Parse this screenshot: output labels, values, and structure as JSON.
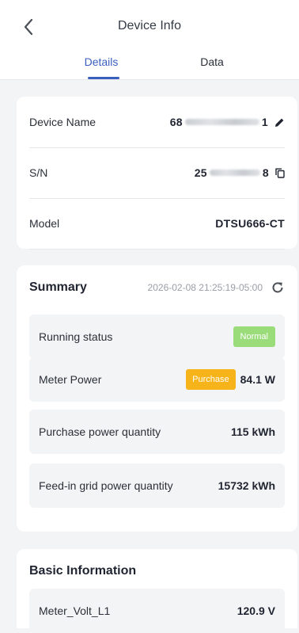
{
  "header": {
    "title": "Device Info",
    "tabs": [
      {
        "label": "Details",
        "active": true
      },
      {
        "label": "Data",
        "active": false
      }
    ]
  },
  "device": {
    "rows": [
      {
        "label": "Device Name",
        "value_start": "68",
        "value_end": "1",
        "action_icon": "pencil-icon"
      },
      {
        "label": "S/N",
        "value_start": "25",
        "value_end": "8",
        "action_icon": "copy-icon"
      },
      {
        "label": "Model",
        "value": "DTSU666-CT"
      }
    ]
  },
  "summary": {
    "title": "Summary",
    "timestamp": "2026-02-08 21:25:19-05:00",
    "running_status": {
      "label": "Running status",
      "badge": "Normal"
    },
    "meter_power": {
      "label": "Meter Power",
      "badge": "Purchase",
      "value": "84.1 W"
    },
    "purchase_power": {
      "label": "Purchase power quantity",
      "value": "115 kWh"
    },
    "feed_in": {
      "label": "Feed-in grid power quantity",
      "value": "15732 kWh"
    }
  },
  "basic_info": {
    "title": "Basic Information",
    "rows": [
      {
        "label": "Meter_Volt_L1",
        "value": "120.9 V"
      }
    ]
  },
  "colors": {
    "accent": "#3a5fbf",
    "normal_badge": "#9bdc7a",
    "purchase_badge": "#f6b31a",
    "background": "#f3f4f6"
  }
}
